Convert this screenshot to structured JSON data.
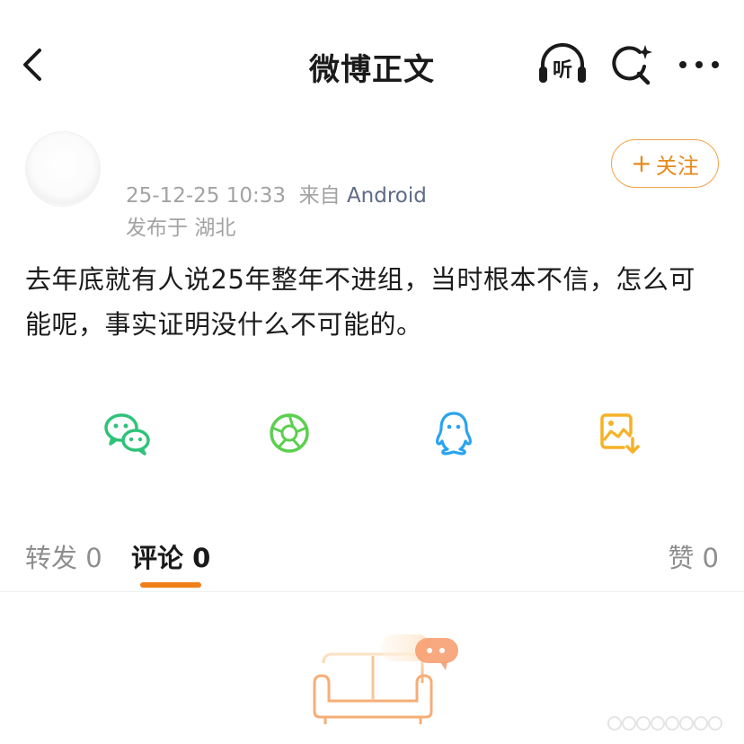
{
  "header": {
    "title": "微博正文",
    "listen_label": "听",
    "icons": {
      "back": "chevron-left-icon",
      "listen": "headphones-icon",
      "search": "search-sparkle-icon",
      "more": "more-dots-icon"
    }
  },
  "author": {
    "timestamp": "25-12-25 10:33",
    "source_prefix": "来自",
    "source": "Android",
    "location_prefix": "发布于",
    "location": "湖北",
    "follow_label": "关注"
  },
  "post": {
    "text": "去年底就有人说25年整年不进组，当时根本不信，怎么可能呢，事实证明没什么不可能的。"
  },
  "share": {
    "icons": [
      "wechat-icon",
      "moments-icon",
      "qq-icon",
      "save-image-icon"
    ],
    "colors": {
      "wechat": "#2fc37a",
      "moments": "#5ccf4f",
      "qq": "#2aa3f0",
      "save": "#f5b227"
    }
  },
  "tabs": {
    "repost": {
      "label": "转发",
      "count": "0"
    },
    "comment": {
      "label": "评论",
      "count": "0"
    },
    "like": {
      "label": "赞",
      "count": "0"
    }
  },
  "colors": {
    "accent": "#f07f1b",
    "follow_border": "#f0a449",
    "meta": "#a3a3a3",
    "source": "#5d6b86"
  }
}
